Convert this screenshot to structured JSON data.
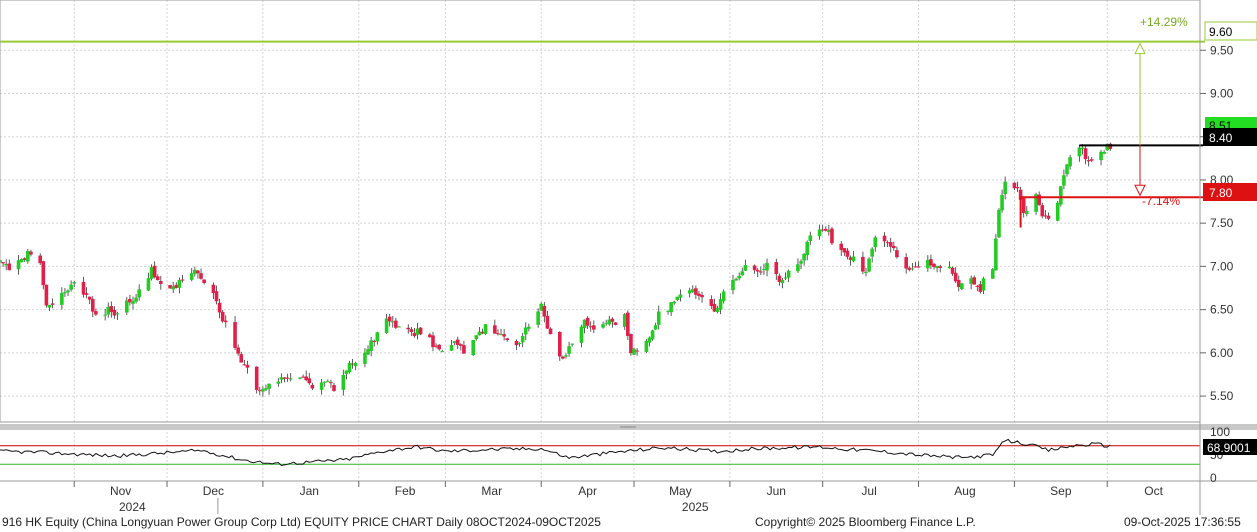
{
  "chart_data": [
    {
      "type": "candlestick",
      "ticker": "916 HK Equity",
      "y_ticks": [
        "5.50",
        "6.00",
        "6.50",
        "7.00",
        "7.50",
        "8.00",
        "8.50",
        "9.00",
        "9.50"
      ],
      "y_range": [
        5.2,
        9.85
      ],
      "x_range": [
        "2024-10-08",
        "2025-10-31"
      ],
      "month_ticks": [
        {
          "date": "2024-11-01",
          "label": "Nov"
        },
        {
          "date": "2024-12-01",
          "label": "Dec"
        },
        {
          "date": "2025-01-01",
          "label": "Jan"
        },
        {
          "date": "2025-02-01",
          "label": "Feb"
        },
        {
          "date": "2025-03-01",
          "label": "Mar"
        },
        {
          "date": "2025-04-01",
          "label": "Apr"
        },
        {
          "date": "2025-05-01",
          "label": "May"
        },
        {
          "date": "2025-06-01",
          "label": "Jun"
        },
        {
          "date": "2025-07-01",
          "label": "Jul"
        },
        {
          "date": "2025-08-01",
          "label": "Aug"
        },
        {
          "date": "2025-09-01",
          "label": "Sep"
        },
        {
          "date": "2025-10-01",
          "label": "Oct"
        }
      ],
      "year_labels": [
        {
          "date": "2024-12-01",
          "label": "2024"
        },
        {
          "date": "2025-06-01",
          "label": "2025"
        }
      ],
      "close_path": [
        [
          "2024-10-08",
          7.05
        ],
        [
          "2024-10-11",
          6.98
        ],
        [
          "2024-10-15",
          7.1
        ],
        [
          "2024-10-18",
          7.15
        ],
        [
          "2024-10-21",
          7.0
        ],
        [
          "2024-10-23",
          6.55
        ],
        [
          "2024-10-25",
          6.6
        ],
        [
          "2024-10-29",
          6.75
        ],
        [
          "2024-11-01",
          6.8
        ],
        [
          "2024-11-04",
          6.7
        ],
        [
          "2024-11-07",
          6.5
        ],
        [
          "2024-11-09",
          6.3
        ],
        [
          "2024-11-12",
          6.5
        ],
        [
          "2024-11-15",
          6.45
        ],
        [
          "2024-11-19",
          6.6
        ],
        [
          "2024-11-22",
          6.7
        ],
        [
          "2024-11-26",
          6.95
        ],
        [
          "2024-11-29",
          6.78
        ],
        [
          "2024-12-03",
          6.75
        ],
        [
          "2024-12-06",
          6.85
        ],
        [
          "2024-12-10",
          7.0
        ],
        [
          "2024-12-13",
          6.85
        ],
        [
          "2024-12-16",
          6.65
        ],
        [
          "2024-12-19",
          6.4
        ],
        [
          "2024-12-23",
          6.05
        ],
        [
          "2024-12-27",
          5.8
        ],
        [
          "2024-12-31",
          5.55
        ],
        [
          "2025-01-03",
          5.62
        ],
        [
          "2025-01-07",
          5.68
        ],
        [
          "2025-01-10",
          5.75
        ],
        [
          "2025-01-14",
          5.7
        ],
        [
          "2025-01-17",
          5.62
        ],
        [
          "2025-01-21",
          5.7
        ],
        [
          "2025-01-24",
          5.6
        ],
        [
          "2025-01-28",
          5.8
        ],
        [
          "2025-02-03",
          6.0
        ],
        [
          "2025-02-07",
          6.2
        ],
        [
          "2025-02-11",
          6.4
        ],
        [
          "2025-02-14",
          6.3
        ],
        [
          "2025-02-18",
          6.2
        ],
        [
          "2025-02-21",
          6.25
        ],
        [
          "2025-02-25",
          6.1
        ],
        [
          "2025-02-28",
          6.05
        ],
        [
          "2025-03-04",
          6.1
        ],
        [
          "2025-03-07",
          6.0
        ],
        [
          "2025-03-11",
          6.2
        ],
        [
          "2025-03-14",
          6.3
        ],
        [
          "2025-03-18",
          6.25
        ],
        [
          "2025-03-21",
          6.15
        ],
        [
          "2025-03-25",
          6.1
        ],
        [
          "2025-03-28",
          6.35
        ],
        [
          "2025-04-01",
          6.55
        ],
        [
          "2025-04-04",
          6.2
        ],
        [
          "2025-04-08",
          5.9
        ],
        [
          "2025-04-11",
          6.15
        ],
        [
          "2025-04-15",
          6.35
        ],
        [
          "2025-04-18",
          6.25
        ],
        [
          "2025-04-23",
          6.35
        ],
        [
          "2025-04-28",
          6.4
        ],
        [
          "2025-04-30",
          6.0
        ],
        [
          "2025-05-06",
          6.15
        ],
        [
          "2025-05-09",
          6.45
        ],
        [
          "2025-05-13",
          6.55
        ],
        [
          "2025-05-16",
          6.7
        ],
        [
          "2025-05-20",
          6.75
        ],
        [
          "2025-05-23",
          6.65
        ],
        [
          "2025-05-27",
          6.45
        ],
        [
          "2025-05-30",
          6.7
        ],
        [
          "2025-06-03",
          6.85
        ],
        [
          "2025-06-06",
          7.0
        ],
        [
          "2025-06-10",
          6.9
        ],
        [
          "2025-06-13",
          7.0
        ],
        [
          "2025-06-17",
          6.85
        ],
        [
          "2025-06-20",
          6.95
        ],
        [
          "2025-06-24",
          7.1
        ],
        [
          "2025-06-27",
          7.35
        ],
        [
          "2025-07-02",
          7.45
        ],
        [
          "2025-07-05",
          7.25
        ],
        [
          "2025-07-09",
          7.15
        ],
        [
          "2025-07-12",
          7.05
        ],
        [
          "2025-07-15",
          6.9
        ],
        [
          "2025-07-18",
          7.35
        ],
        [
          "2025-07-22",
          7.3
        ],
        [
          "2025-07-25",
          7.15
        ],
        [
          "2025-07-29",
          6.95
        ],
        [
          "2025-08-01",
          6.95
        ],
        [
          "2025-08-05",
          7.05
        ],
        [
          "2025-08-08",
          7.0
        ],
        [
          "2025-08-11",
          6.95
        ],
        [
          "2025-08-14",
          6.8
        ],
        [
          "2025-08-18",
          6.85
        ],
        [
          "2025-08-21",
          6.75
        ],
        [
          "2025-08-25",
          7.0
        ],
        [
          "2025-08-27",
          7.7
        ],
        [
          "2025-08-29",
          7.95
        ],
        [
          "2025-09-02",
          7.95
        ],
        [
          "2025-09-04",
          7.6
        ],
        [
          "2025-09-08",
          7.8
        ],
        [
          "2025-09-10",
          7.6
        ],
        [
          "2025-09-12",
          7.55
        ],
        [
          "2025-09-15",
          7.75
        ],
        [
          "2025-09-17",
          8.1
        ],
        [
          "2025-09-19",
          8.3
        ],
        [
          "2025-09-23",
          8.35
        ],
        [
          "2025-09-25",
          8.2
        ],
        [
          "2025-09-29",
          8.35
        ],
        [
          "2025-10-02",
          8.4
        ]
      ],
      "seed": 916
    },
    {
      "type": "line",
      "panel": "indicator",
      "y_ticks": [
        "0",
        "50",
        "100"
      ],
      "y_range": [
        0,
        100
      ],
      "last_value": "68.9001",
      "levels": [
        {
          "value": 70,
          "color": "#cc0000"
        },
        {
          "value": 30,
          "color": "#2eb82e"
        }
      ],
      "line_path": [
        [
          "2024-10-08",
          58
        ],
        [
          "2024-10-20",
          56
        ],
        [
          "2024-11-01",
          52
        ],
        [
          "2024-11-15",
          48
        ],
        [
          "2024-12-01",
          55
        ],
        [
          "2024-12-12",
          60
        ],
        [
          "2024-12-25",
          40
        ],
        [
          "2025-01-05",
          30
        ],
        [
          "2025-01-15",
          34
        ],
        [
          "2025-01-28",
          40
        ],
        [
          "2025-02-10",
          60
        ],
        [
          "2025-02-20",
          68
        ],
        [
          "2025-03-01",
          58
        ],
        [
          "2025-03-15",
          62
        ],
        [
          "2025-04-01",
          64
        ],
        [
          "2025-04-10",
          44
        ],
        [
          "2025-04-25",
          56
        ],
        [
          "2025-05-10",
          66
        ],
        [
          "2025-05-28",
          58
        ],
        [
          "2025-06-10",
          64
        ],
        [
          "2025-06-30",
          68
        ],
        [
          "2025-07-10",
          62
        ],
        [
          "2025-07-20",
          58
        ],
        [
          "2025-08-01",
          50
        ],
        [
          "2025-08-15",
          44
        ],
        [
          "2025-08-25",
          50
        ],
        [
          "2025-08-29",
          82
        ],
        [
          "2025-09-05",
          74
        ],
        [
          "2025-09-12",
          60
        ],
        [
          "2025-09-20",
          70
        ],
        [
          "2025-09-27",
          74
        ],
        [
          "2025-10-02",
          69
        ]
      ]
    }
  ],
  "price_labels": {
    "upper": "9.60",
    "last": "8.51",
    "current": "8.40",
    "lower": "7.80"
  },
  "percent_labels": {
    "up": "+14.29%",
    "down": "-7.14%"
  },
  "footer": {
    "title": "916 HK Equity (China Longyuan Power Group Corp Ltd) EQUITY PRICE CHART Daily 08OCT2024-09OCT2025",
    "copyright": "Copyright© 2025 Bloomberg Finance L.P.",
    "timestamp": "09-Oct-2025 17:36:55"
  },
  "colors": {
    "up": "#22cc22",
    "down": "#e0204a",
    "upper_line": "#99cc33",
    "lower_line": "#dd1111",
    "current_line": "#000000",
    "grid": "#d4d4d4"
  }
}
